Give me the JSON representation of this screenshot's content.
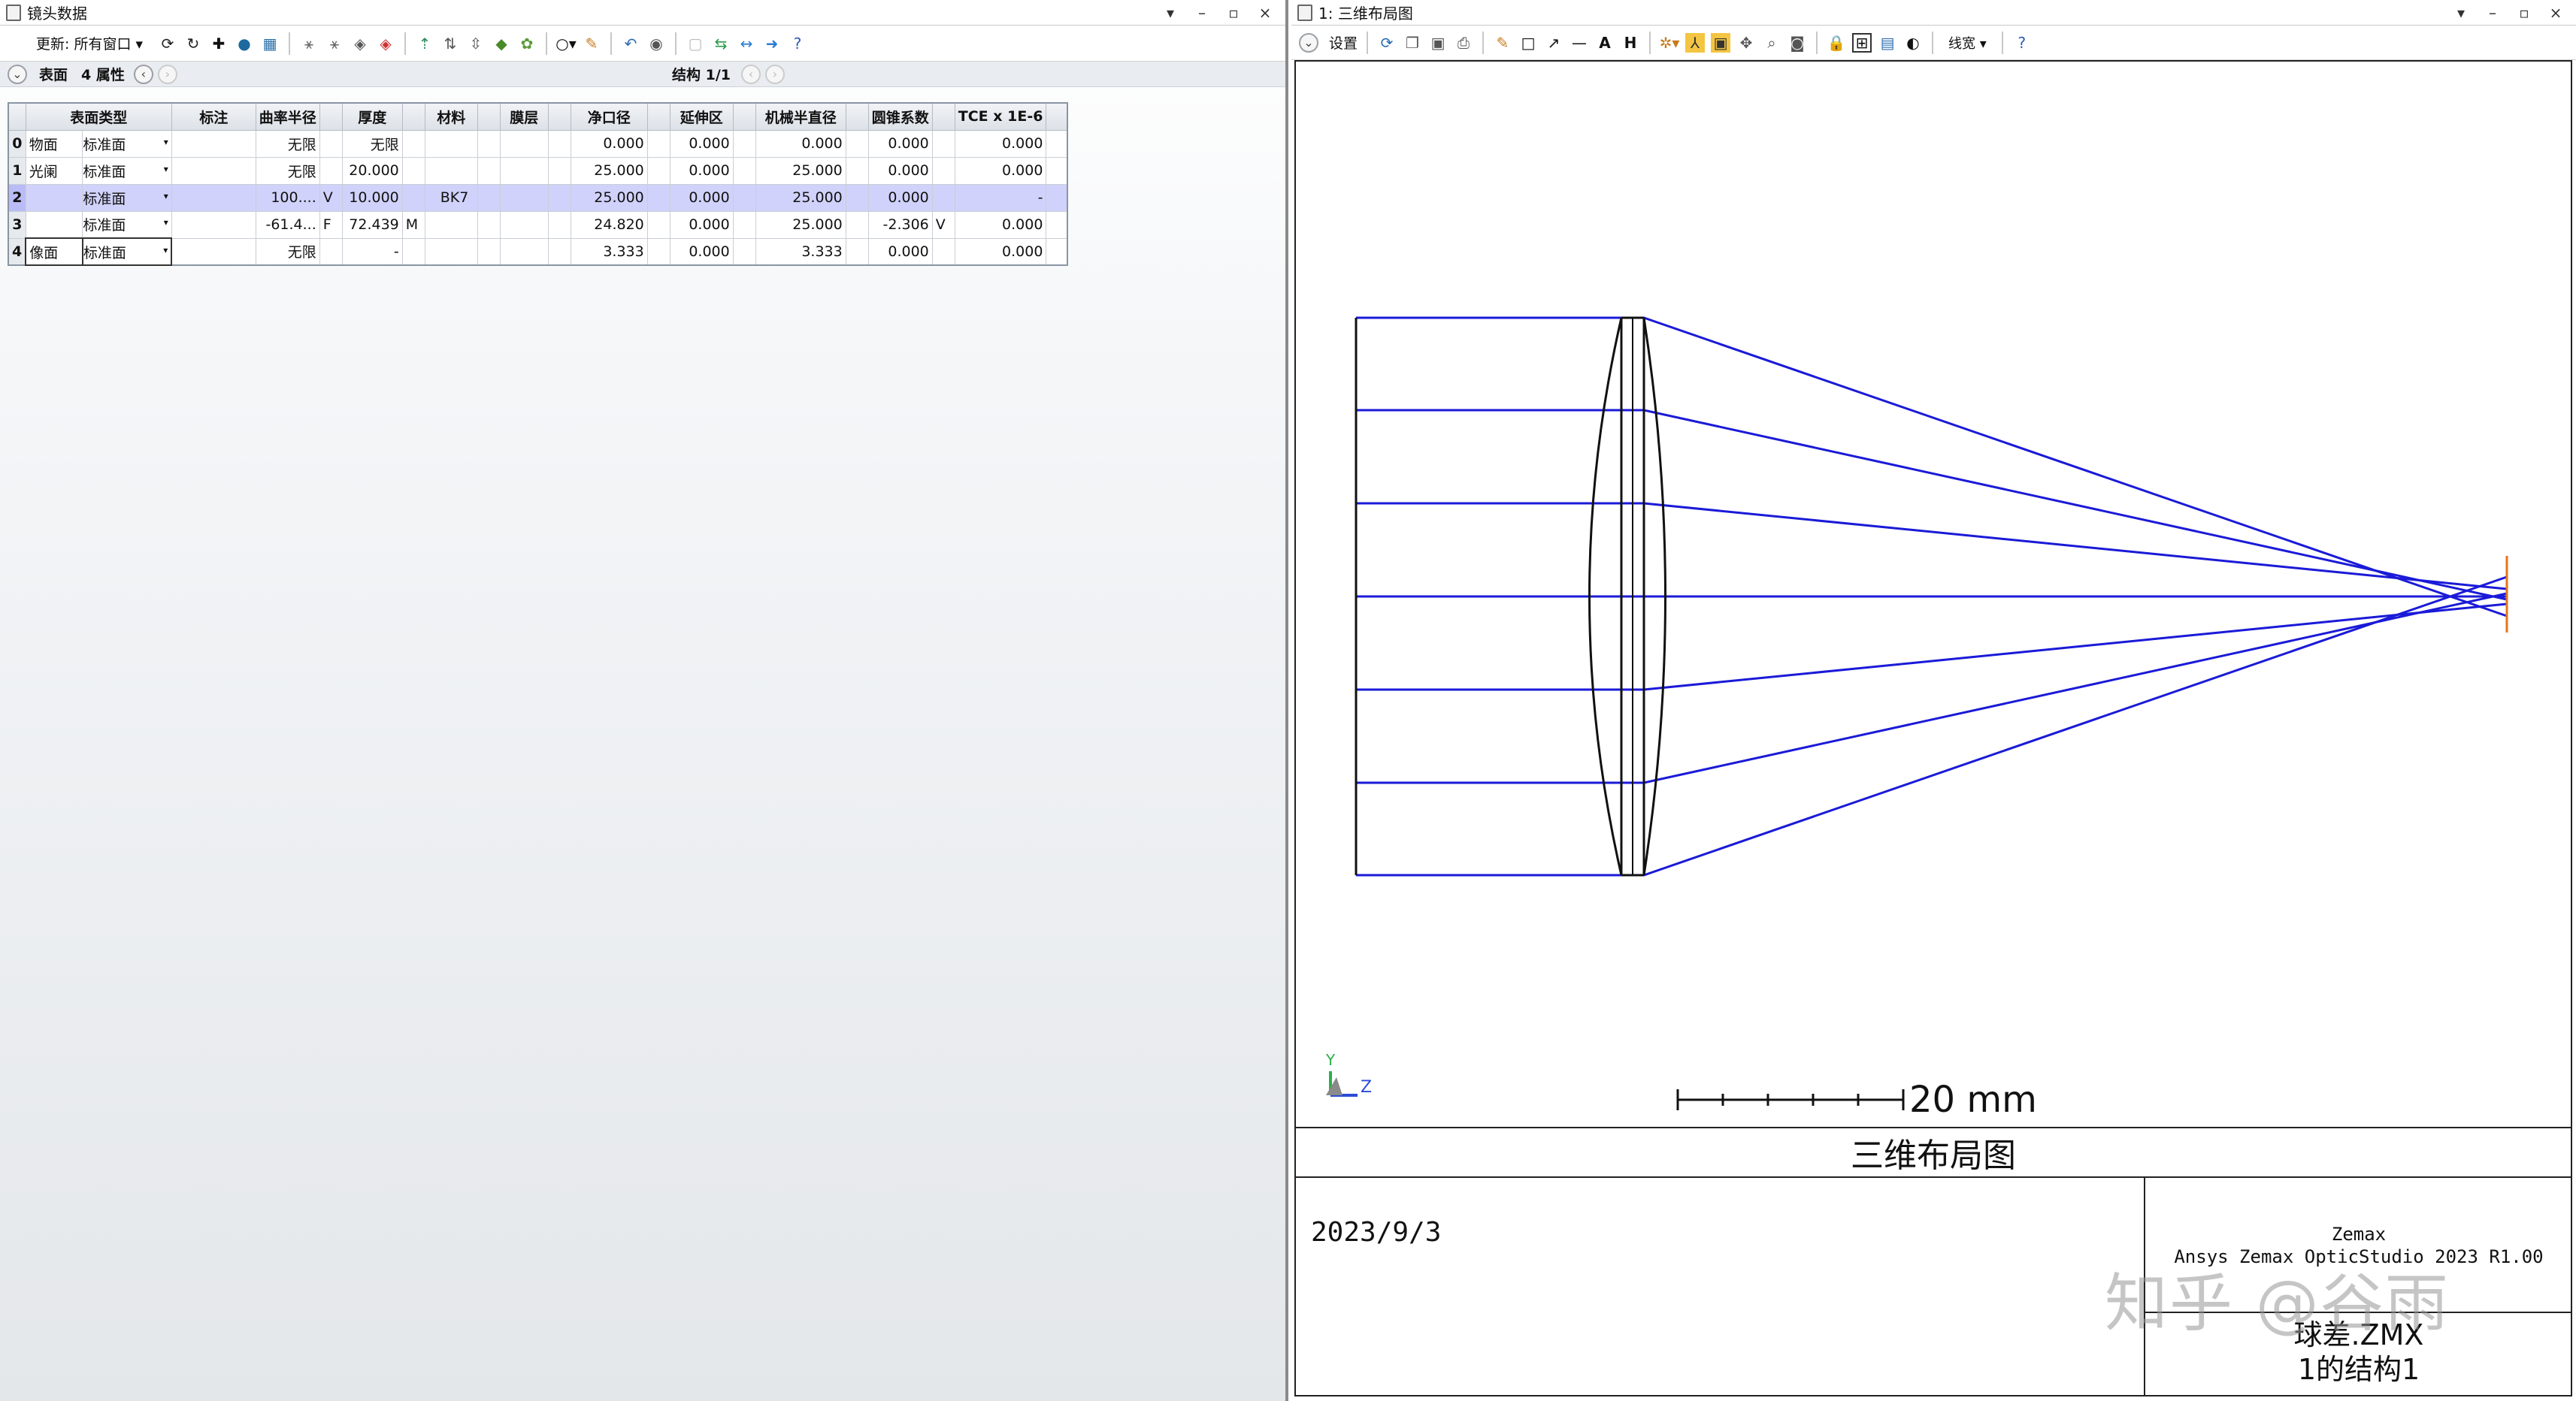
{
  "left_window": {
    "title": "镜头数据",
    "controls": [
      "▾",
      "–",
      "▫",
      "×"
    ],
    "toolbar": {
      "update_label": "更新: 所有窗口 ▾",
      "icons": [
        "refresh-icon",
        "refresh-all-icon",
        "add-icon",
        "globe-icon",
        "cube-icon",
        "wand-icon",
        "wand2-icon",
        "lens-icon",
        "lens-red-icon",
        "arrow-up-icon",
        "arrow-split-icon",
        "arrow-join-icon",
        "turtle-icon",
        "settings-gear-icon",
        "circle-icon",
        "pencil-icon",
        "undo-icon",
        "eye-icon",
        "blank-icon",
        "swap-icon",
        "double-arrow-icon",
        "arrow-right-icon",
        "help-icon"
      ]
    },
    "subbar": {
      "label_surface": "表面",
      "label_props": "4 属性",
      "config": "结构 1/1"
    },
    "table": {
      "headers": [
        "",
        "表面类型",
        "",
        "标注",
        "曲率半径",
        "",
        "厚度",
        "",
        "材料",
        "",
        "膜层",
        "",
        "净口径",
        "",
        "延伸区",
        "",
        "机械半直径",
        "",
        "圆锥系数",
        "",
        "TCE x 1E-6",
        ""
      ],
      "rows": [
        {
          "idx": "0",
          "name": "物面",
          "type": "标准面",
          "comment": "",
          "radius": "无限",
          "rsolve": "",
          "thickness": "无限",
          "tsolve": "",
          "material": "",
          "coating": "",
          "clear": "0.000",
          "chip": "0.000",
          "mech": "0.000",
          "conic": "0.000",
          "csolve": "",
          "tce": "0.000"
        },
        {
          "idx": "1",
          "name": "光阑",
          "type": "标准面",
          "comment": "",
          "radius": "无限",
          "rsolve": "",
          "thickness": "20.000",
          "tsolve": "",
          "material": "",
          "coating": "",
          "clear": "25.000",
          "chip": "0.000",
          "mech": "25.000",
          "conic": "0.000",
          "csolve": "",
          "tce": "0.000"
        },
        {
          "idx": "2",
          "name": "",
          "type": "标准面",
          "comment": "",
          "radius": "100....",
          "rsolve": "V",
          "thickness": "10.000",
          "tsolve": "",
          "material": "BK7",
          "coating": "",
          "clear": "25.000",
          "chip": "0.000",
          "mech": "25.000",
          "conic": "0.000",
          "csolve": "",
          "tce": "-"
        },
        {
          "idx": "3",
          "name": "",
          "type": "标准面",
          "comment": "",
          "radius": "-61.4...",
          "rsolve": "F",
          "thickness": "72.439",
          "tsolve": "M",
          "material": "",
          "coating": "",
          "clear": "24.820",
          "chip": "0.000",
          "mech": "25.000",
          "conic": "-2.306",
          "csolve": "V",
          "tce": "0.000"
        },
        {
          "idx": "4",
          "name": "像面",
          "type": "标准面",
          "comment": "",
          "radius": "无限",
          "rsolve": "",
          "thickness": "-",
          "tsolve": "",
          "material": "",
          "coating": "",
          "clear": "3.333",
          "chip": "0.000",
          "mech": "3.333",
          "conic": "0.000",
          "csolve": "",
          "tce": "0.000"
        }
      ]
    }
  },
  "right_window": {
    "title": "1: 三维布局图",
    "controls": [
      "▾",
      "–",
      "▫",
      "×"
    ],
    "toolbar": {
      "settings_label": "设置",
      "linewidth_label": "线宽 ▾"
    },
    "axis_labels": {
      "y": "Y",
      "z": "Z"
    },
    "scale_bar": "20 mm",
    "footer": {
      "title": "三维布局图",
      "date": "2023/9/3",
      "brand_line1": "Zemax",
      "brand_line2": "Ansys Zemax OpticStudio 2023 R1.00",
      "file_name": "球差.ZMX",
      "config": "1的结构1"
    },
    "colors": {
      "rays": "#1a1ad8",
      "lens": "#111111",
      "image_plane": "#e8731a"
    }
  },
  "watermark": "知乎 @谷雨"
}
